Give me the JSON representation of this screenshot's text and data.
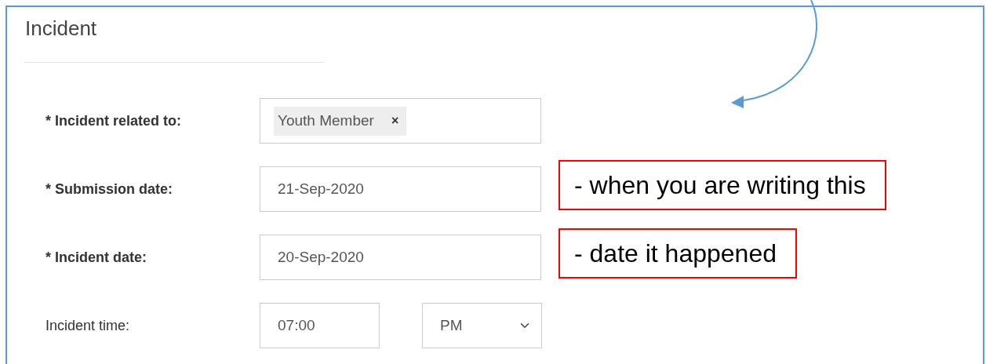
{
  "section": {
    "title": "Incident"
  },
  "fields": [
    {
      "kind": "tags",
      "label": "* Incident related to:",
      "required": true,
      "tags": [
        {
          "text": "Youth Member",
          "remove": "×"
        }
      ]
    },
    {
      "kind": "text",
      "label": "* Submission date:",
      "required": true,
      "value": "21-Sep-2020",
      "note": "- when you are writing this"
    },
    {
      "kind": "text",
      "label": "* Incident date:",
      "required": true,
      "value": "20-Sep-2020",
      "note": "- date it happened"
    },
    {
      "kind": "time",
      "label": "Incident time:",
      "required": false,
      "value": "07:00",
      "period": "PM"
    }
  ]
}
